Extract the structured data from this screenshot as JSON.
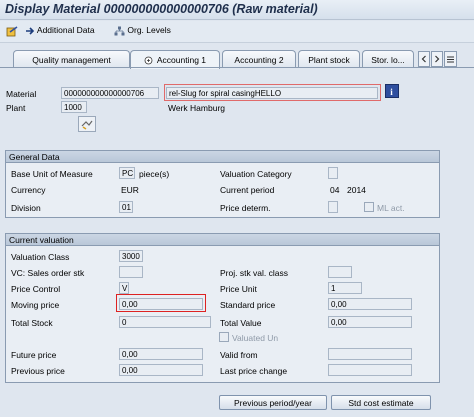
{
  "title": "Display Material 000000000000000706 (Raw material)",
  "toolbar": {
    "additional_data": "Additional Data",
    "org_levels": "Org. Levels"
  },
  "tabs": [
    "Quality management",
    "Accounting 1",
    "Accounting 2",
    "Plant stock",
    "Stor. lo..."
  ],
  "header": {
    "material_label": "Material",
    "material_value": "000000000000000706",
    "material_desc": "rel-Slug for spiral casingHELLO",
    "plant_label": "Plant",
    "plant_value": "1000",
    "plant_desc": "Werk Hamburg"
  },
  "general": {
    "title": "General Data",
    "base_uom_label": "Base Unit of Measure",
    "base_uom_value": "PC",
    "base_uom_text": "piece(s)",
    "valuation_category_label": "Valuation Category",
    "currency_label": "Currency",
    "currency_value": "EUR",
    "current_period_label": "Current period",
    "current_period_month": "04",
    "current_period_year": "2014",
    "division_label": "Division",
    "division_value": "01",
    "price_determ_label": "Price determ.",
    "ml_act_label": "ML act."
  },
  "valuation": {
    "title": "Current valuation",
    "valuation_class_label": "Valuation Class",
    "valuation_class_value": "3000",
    "vc_sales_label": "VC: Sales order stk",
    "proj_stk_label": "Proj. stk val. class",
    "price_control_label": "Price Control",
    "price_control_value": "V",
    "price_unit_label": "Price Unit",
    "price_unit_value": "1",
    "moving_price_label": "Moving price",
    "moving_price_value": "0,00",
    "standard_price_label": "Standard price",
    "standard_price_value": "0,00",
    "total_stock_label": "Total Stock",
    "total_stock_value": "0",
    "total_value_label": "Total Value",
    "total_value_value": "0,00",
    "valuated_un_label": "Valuated Un",
    "future_price_label": "Future price",
    "future_price_value": "0,00",
    "valid_from_label": "Valid from",
    "previous_price_label": "Previous price",
    "previous_price_value": "0,00",
    "last_price_change_label": "Last price change"
  },
  "buttons": {
    "previous_period": "Previous period/year",
    "std_cost_estimate": "Std cost estimate"
  },
  "icons": [
    "display-change-icon",
    "additional-data-icon",
    "org-levels-icon",
    "tab-scroll-icon",
    "info-icon",
    "long-text-icon"
  ]
}
